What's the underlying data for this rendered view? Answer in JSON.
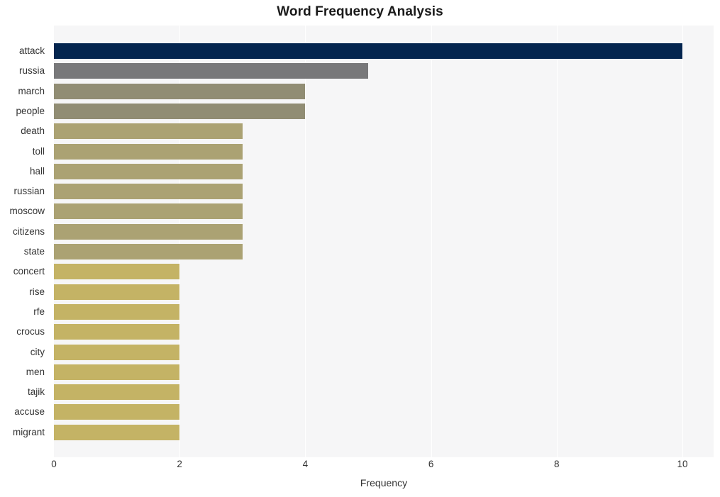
{
  "chart_data": {
    "type": "bar",
    "orientation": "horizontal",
    "title": "Word Frequency Analysis",
    "xlabel": "Frequency",
    "ylabel": "",
    "xlim": [
      0,
      10
    ],
    "xticks": [
      0,
      2,
      4,
      6,
      8,
      10
    ],
    "grid": "vertical-white-gridlines",
    "legend": "none",
    "plot_background": "#f6f6f7",
    "categories": [
      "attack",
      "russia",
      "march",
      "people",
      "death",
      "toll",
      "hall",
      "russian",
      "moscow",
      "citizens",
      "state",
      "concert",
      "rise",
      "rfe",
      "crocus",
      "city",
      "men",
      "tajik",
      "accuse",
      "migrant"
    ],
    "values": [
      10,
      5,
      4,
      4,
      3,
      3,
      3,
      3,
      3,
      3,
      3,
      2,
      2,
      2,
      2,
      2,
      2,
      2,
      2,
      2
    ],
    "bar_colors": [
      "#04254f",
      "#78787a",
      "#918d74",
      "#918d74",
      "#aba273",
      "#aba273",
      "#aba273",
      "#aba273",
      "#aba273",
      "#aba273",
      "#aba273",
      "#c4b365",
      "#c4b365",
      "#c4b365",
      "#c4b365",
      "#c4b365",
      "#c4b365",
      "#c4b365",
      "#c4b365",
      "#c4b365"
    ]
  }
}
